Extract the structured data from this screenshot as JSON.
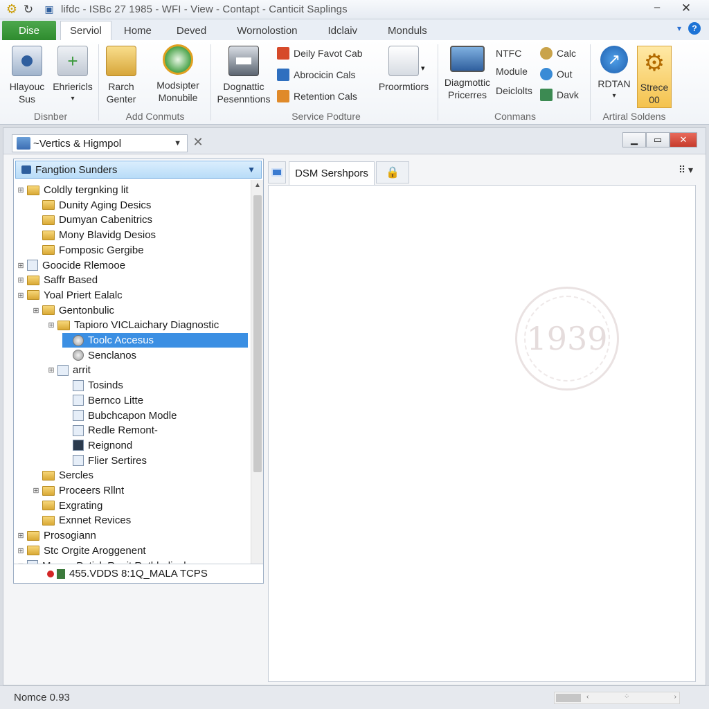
{
  "window": {
    "title": "lifdc - ISBc 27 1985 - WFI - View - Contapt - Canticit Saplings",
    "minimize_glyph": "–",
    "close_glyph": "✕"
  },
  "ribbon_tabs": {
    "file": "Dise",
    "tabs": [
      "Serviol",
      "Home",
      "Deved",
      "Wornolostion",
      "Idclaiv",
      "Monduls"
    ]
  },
  "ribbon": {
    "groups": [
      {
        "label": "Disnber"
      },
      {
        "label": "Add Conmuts"
      },
      {
        "label": "Service Podture"
      },
      {
        "label": "Conmans"
      },
      {
        "label": "Artiral Soldens"
      }
    ],
    "buttons": {
      "hlayouc": "Hlayouc\nSus",
      "ehrierics": "Ehriericls",
      "rarch": "Rarch\nGenter",
      "modsipter": "Modsipter\nMonubile",
      "dognattic": "Dognattic\nPesenntions",
      "proormtiors": "Proormtiors",
      "diagmottic": "Diagmottic\nPricerres",
      "rdtan": "RDTAN",
      "strece": "Strece\n00"
    },
    "small_buttons": {
      "daily": "Deily Favot Cab",
      "abrocicin": "Abrocicin Cals",
      "retention": "Retention Cals",
      "ntfc": "NTFC",
      "module": "Module",
      "deiclolts": "Deiclolts",
      "calc": "Calc",
      "out": "Out",
      "davk": "Davk"
    }
  },
  "workspace": {
    "combo_value": "~Vertics & Higmpol",
    "tree_header": "Fangtion Sunders",
    "tree_items": [
      {
        "label": "Coldly tergnking lit",
        "icon": "folder",
        "indent": 0,
        "exp": "+"
      },
      {
        "label": "Dunity Aging Desics",
        "icon": "folder",
        "indent": 1,
        "exp": ""
      },
      {
        "label": "Dumyan Cabenitrics",
        "icon": "folder",
        "indent": 1,
        "exp": ""
      },
      {
        "label": "Mony Blavidg Desios",
        "icon": "folder",
        "indent": 1,
        "exp": ""
      },
      {
        "label": "Fomposic Gergibe",
        "icon": "folder",
        "indent": 1,
        "exp": ""
      },
      {
        "label": "Goocide Rlemooe",
        "icon": "doc",
        "indent": 0,
        "exp": "+"
      },
      {
        "label": "Saffr Based",
        "icon": "folder",
        "indent": 0,
        "exp": "+"
      },
      {
        "label": "Yoal Priert Ealalc",
        "icon": "folder",
        "indent": 0,
        "exp": "+"
      },
      {
        "label": "Gentonbulic",
        "icon": "folder",
        "indent": 1,
        "exp": "+"
      },
      {
        "label": "Tapioro VICLaichary Diagnostic",
        "icon": "folder",
        "indent": 2,
        "exp": "+"
      },
      {
        "label": "Toolc Accesus",
        "icon": "globe",
        "indent": 3,
        "exp": "",
        "selected": true
      },
      {
        "label": "Senclanos",
        "icon": "globe",
        "indent": 3,
        "exp": ""
      },
      {
        "label": "arrit",
        "icon": "doc",
        "indent": 2,
        "exp": "+"
      },
      {
        "label": "Tosinds",
        "icon": "doc",
        "indent": 3,
        "exp": ""
      },
      {
        "label": "Bernco Litte",
        "icon": "doc",
        "indent": 3,
        "exp": ""
      },
      {
        "label": "Bubchcapon Modle",
        "icon": "doc",
        "indent": 3,
        "exp": ""
      },
      {
        "label": "Redle Remont-",
        "icon": "doc",
        "indent": 3,
        "exp": ""
      },
      {
        "label": "Reignond",
        "icon": "docdark",
        "indent": 3,
        "exp": ""
      },
      {
        "label": "Flier Sertires",
        "icon": "doc",
        "indent": 3,
        "exp": ""
      },
      {
        "label": "Sercles",
        "icon": "folder",
        "indent": 1,
        "exp": ""
      },
      {
        "label": "Proceers Rllnt",
        "icon": "folder",
        "indent": 1,
        "exp": "+"
      },
      {
        "label": "Exgrating",
        "icon": "folder",
        "indent": 1,
        "exp": ""
      },
      {
        "label": "Exnnet Revices",
        "icon": "folder",
        "indent": 1,
        "exp": ""
      },
      {
        "label": "Prosogiann",
        "icon": "folder",
        "indent": 0,
        "exp": "+"
      },
      {
        "label": "Stc Orgite Aroggenent",
        "icon": "folder",
        "indent": 0,
        "exp": "+"
      },
      {
        "label": "Mongy Putick Renit Rethbuliosl",
        "icon": "doc",
        "indent": 0,
        "exp": "+"
      }
    ],
    "tree_footer": "455.VDDS 8:1Q_MALA TCPS",
    "document_tab": "DSM Sershpors",
    "watermark_text": "1939"
  },
  "statusbar": {
    "text": "Nomce 0.93"
  }
}
